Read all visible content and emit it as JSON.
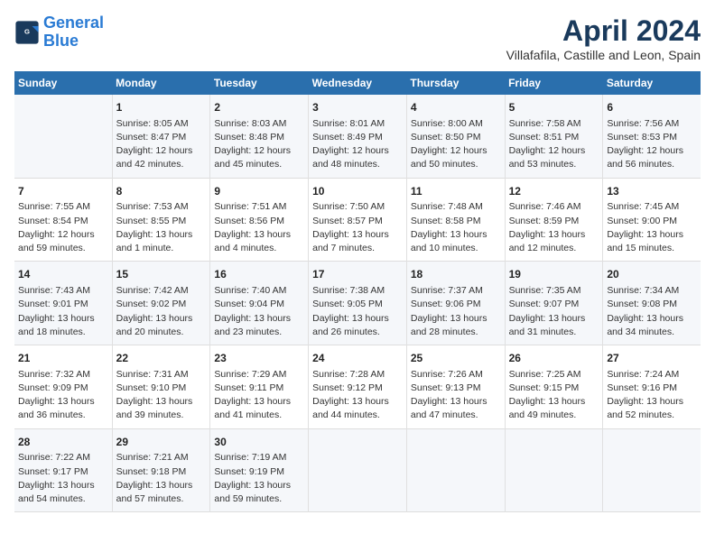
{
  "header": {
    "logo_line1": "General",
    "logo_line2": "Blue",
    "title": "April 2024",
    "subtitle": "Villafafila, Castille and Leon, Spain"
  },
  "days_of_week": [
    "Sunday",
    "Monday",
    "Tuesday",
    "Wednesday",
    "Thursday",
    "Friday",
    "Saturday"
  ],
  "weeks": [
    [
      {
        "day": "",
        "content": ""
      },
      {
        "day": "1",
        "content": "Sunrise: 8:05 AM\nSunset: 8:47 PM\nDaylight: 12 hours\nand 42 minutes."
      },
      {
        "day": "2",
        "content": "Sunrise: 8:03 AM\nSunset: 8:48 PM\nDaylight: 12 hours\nand 45 minutes."
      },
      {
        "day": "3",
        "content": "Sunrise: 8:01 AM\nSunset: 8:49 PM\nDaylight: 12 hours\nand 48 minutes."
      },
      {
        "day": "4",
        "content": "Sunrise: 8:00 AM\nSunset: 8:50 PM\nDaylight: 12 hours\nand 50 minutes."
      },
      {
        "day": "5",
        "content": "Sunrise: 7:58 AM\nSunset: 8:51 PM\nDaylight: 12 hours\nand 53 minutes."
      },
      {
        "day": "6",
        "content": "Sunrise: 7:56 AM\nSunset: 8:53 PM\nDaylight: 12 hours\nand 56 minutes."
      }
    ],
    [
      {
        "day": "7",
        "content": "Sunrise: 7:55 AM\nSunset: 8:54 PM\nDaylight: 12 hours\nand 59 minutes."
      },
      {
        "day": "8",
        "content": "Sunrise: 7:53 AM\nSunset: 8:55 PM\nDaylight: 13 hours\nand 1 minute."
      },
      {
        "day": "9",
        "content": "Sunrise: 7:51 AM\nSunset: 8:56 PM\nDaylight: 13 hours\nand 4 minutes."
      },
      {
        "day": "10",
        "content": "Sunrise: 7:50 AM\nSunset: 8:57 PM\nDaylight: 13 hours\nand 7 minutes."
      },
      {
        "day": "11",
        "content": "Sunrise: 7:48 AM\nSunset: 8:58 PM\nDaylight: 13 hours\nand 10 minutes."
      },
      {
        "day": "12",
        "content": "Sunrise: 7:46 AM\nSunset: 8:59 PM\nDaylight: 13 hours\nand 12 minutes."
      },
      {
        "day": "13",
        "content": "Sunrise: 7:45 AM\nSunset: 9:00 PM\nDaylight: 13 hours\nand 15 minutes."
      }
    ],
    [
      {
        "day": "14",
        "content": "Sunrise: 7:43 AM\nSunset: 9:01 PM\nDaylight: 13 hours\nand 18 minutes."
      },
      {
        "day": "15",
        "content": "Sunrise: 7:42 AM\nSunset: 9:02 PM\nDaylight: 13 hours\nand 20 minutes."
      },
      {
        "day": "16",
        "content": "Sunrise: 7:40 AM\nSunset: 9:04 PM\nDaylight: 13 hours\nand 23 minutes."
      },
      {
        "day": "17",
        "content": "Sunrise: 7:38 AM\nSunset: 9:05 PM\nDaylight: 13 hours\nand 26 minutes."
      },
      {
        "day": "18",
        "content": "Sunrise: 7:37 AM\nSunset: 9:06 PM\nDaylight: 13 hours\nand 28 minutes."
      },
      {
        "day": "19",
        "content": "Sunrise: 7:35 AM\nSunset: 9:07 PM\nDaylight: 13 hours\nand 31 minutes."
      },
      {
        "day": "20",
        "content": "Sunrise: 7:34 AM\nSunset: 9:08 PM\nDaylight: 13 hours\nand 34 minutes."
      }
    ],
    [
      {
        "day": "21",
        "content": "Sunrise: 7:32 AM\nSunset: 9:09 PM\nDaylight: 13 hours\nand 36 minutes."
      },
      {
        "day": "22",
        "content": "Sunrise: 7:31 AM\nSunset: 9:10 PM\nDaylight: 13 hours\nand 39 minutes."
      },
      {
        "day": "23",
        "content": "Sunrise: 7:29 AM\nSunset: 9:11 PM\nDaylight: 13 hours\nand 41 minutes."
      },
      {
        "day": "24",
        "content": "Sunrise: 7:28 AM\nSunset: 9:12 PM\nDaylight: 13 hours\nand 44 minutes."
      },
      {
        "day": "25",
        "content": "Sunrise: 7:26 AM\nSunset: 9:13 PM\nDaylight: 13 hours\nand 47 minutes."
      },
      {
        "day": "26",
        "content": "Sunrise: 7:25 AM\nSunset: 9:15 PM\nDaylight: 13 hours\nand 49 minutes."
      },
      {
        "day": "27",
        "content": "Sunrise: 7:24 AM\nSunset: 9:16 PM\nDaylight: 13 hours\nand 52 minutes."
      }
    ],
    [
      {
        "day": "28",
        "content": "Sunrise: 7:22 AM\nSunset: 9:17 PM\nDaylight: 13 hours\nand 54 minutes."
      },
      {
        "day": "29",
        "content": "Sunrise: 7:21 AM\nSunset: 9:18 PM\nDaylight: 13 hours\nand 57 minutes."
      },
      {
        "day": "30",
        "content": "Sunrise: 7:19 AM\nSunset: 9:19 PM\nDaylight: 13 hours\nand 59 minutes."
      },
      {
        "day": "",
        "content": ""
      },
      {
        "day": "",
        "content": ""
      },
      {
        "day": "",
        "content": ""
      },
      {
        "day": "",
        "content": ""
      }
    ]
  ]
}
